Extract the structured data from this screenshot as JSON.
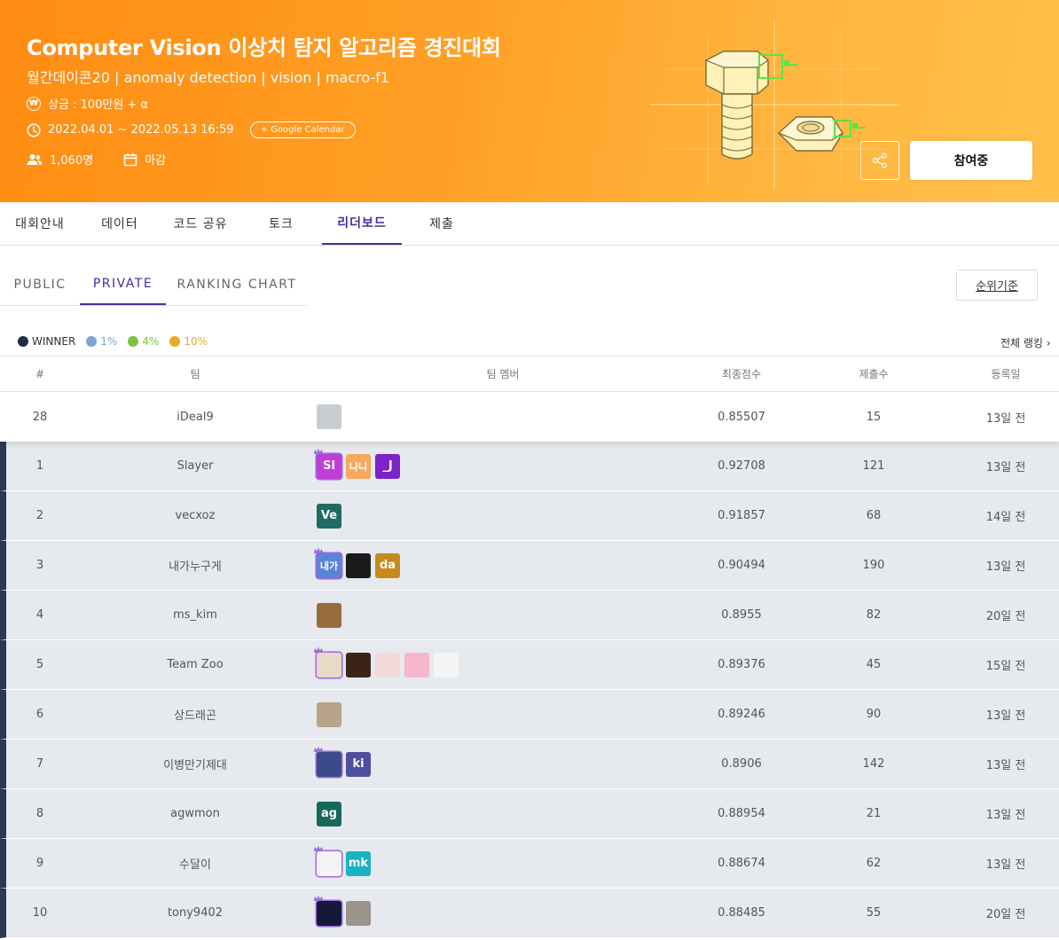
{
  "banner": {
    "title": "Computer Vision 이상치 탐지 알고리즘 경진대회",
    "subtitle": "월간데이콘20 | anomaly detection | vision | macro-f1",
    "prize": "상금 : 100만원 + α",
    "date": "2022.04.01 ~ 2022.05.13 16:59",
    "gcal_label": "+ Google Calendar",
    "participants": "1,060명",
    "status": "마감",
    "join_label": "참여중"
  },
  "main_tabs": [
    "대회안내",
    "데이터",
    "코드 공유",
    "토크",
    "리더보드",
    "제출"
  ],
  "sub_tabs": [
    "PUBLIC",
    "PRIVATE",
    "RANKING CHART"
  ],
  "criteria_label": "순위기준",
  "legend": [
    {
      "label": "WINNER",
      "color": "#1f2d45"
    },
    {
      "label": "1%",
      "color": "#7aa6cf"
    },
    {
      "label": "4%",
      "color": "#7cc342"
    },
    {
      "label": "10%",
      "color": "#e8a92a"
    }
  ],
  "all_ranking_label": "전체 랭킹 ›",
  "table": {
    "headers": {
      "rank": "#",
      "team": "팀",
      "members": "팀 멤버",
      "score": "최종점수",
      "count": "제출수",
      "date": "등록일"
    },
    "my_row": {
      "rank": "28",
      "team": "iDeal9",
      "score": "0.85507",
      "count": "15",
      "date": "13일 전",
      "members": [
        {
          "text": "",
          "color": "#c9cdd2"
        }
      ]
    },
    "rows": [
      {
        "rank": "1",
        "team": "Slayer",
        "score": "0.92708",
        "count": "121",
        "date": "13일 전",
        "members": [
          {
            "text": "Sl",
            "color": "#c03ed6",
            "leader": true
          },
          {
            "text": "나니",
            "color": "#f4a860"
          },
          {
            "text": "_J",
            "color": "#7c22c9"
          }
        ]
      },
      {
        "rank": "2",
        "team": "vecxoz",
        "score": "0.91857",
        "count": "68",
        "date": "14일 전",
        "members": [
          {
            "text": "Ve",
            "color": "#1d6b62"
          }
        ]
      },
      {
        "rank": "3",
        "team": "내가누구게",
        "score": "0.90494",
        "count": "190",
        "date": "13일 전",
        "members": [
          {
            "text": "내가",
            "color": "#5b83d8",
            "leader": true
          },
          {
            "text": "",
            "color": "#1a1a1a"
          },
          {
            "text": "da",
            "color": "#c68a1c"
          }
        ]
      },
      {
        "rank": "4",
        "team": "ms_kim",
        "score": "0.8955",
        "count": "82",
        "date": "20일 전",
        "members": [
          {
            "text": "",
            "color": "#9a6b3a"
          }
        ]
      },
      {
        "rank": "5",
        "team": "Team Zoo",
        "score": "0.89376",
        "count": "45",
        "date": "15일 전",
        "members": [
          {
            "text": "",
            "color": "#e9d9c7",
            "leader": true
          },
          {
            "text": "",
            "color": "#3a2418"
          },
          {
            "text": "",
            "color": "#f3d8d8"
          },
          {
            "text": "",
            "color": "#f6b7cd"
          },
          {
            "text": "",
            "color": "#f4f4f4"
          }
        ]
      },
      {
        "rank": "6",
        "team": "상드래곤",
        "score": "0.89246",
        "count": "90",
        "date": "13일 전",
        "members": [
          {
            "text": "",
            "color": "#b9a48a"
          }
        ]
      },
      {
        "rank": "7",
        "team": "이병만기제대",
        "score": "0.8906",
        "count": "142",
        "date": "13일 전",
        "members": [
          {
            "text": "",
            "color": "#3c4a8a",
            "leader": true
          },
          {
            "text": "ki",
            "color": "#4e4fa0"
          }
        ]
      },
      {
        "rank": "8",
        "team": "agwmon",
        "score": "0.88954",
        "count": "21",
        "date": "13일 전",
        "members": [
          {
            "text": "ag",
            "color": "#17675c"
          }
        ]
      },
      {
        "rank": "9",
        "team": "수달이",
        "score": "0.88674",
        "count": "62",
        "date": "13일 전",
        "members": [
          {
            "text": "",
            "color": "#f4f4f4",
            "leader": true
          },
          {
            "text": "mk",
            "color": "#19b3c4"
          }
        ]
      },
      {
        "rank": "10",
        "team": "tony9402",
        "score": "0.88485",
        "count": "55",
        "date": "20일 전",
        "members": [
          {
            "text": "",
            "color": "#15183a",
            "leader": true
          },
          {
            "text": "",
            "color": "#9a948c"
          }
        ]
      }
    ]
  }
}
